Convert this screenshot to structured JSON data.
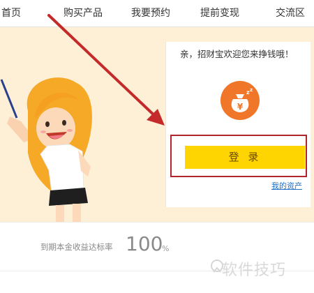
{
  "nav": {
    "items": [
      {
        "label": "首页"
      },
      {
        "label": "购买产品"
      },
      {
        "label": "我要预约"
      },
      {
        "label": "提前变现"
      },
      {
        "label": "交流区"
      }
    ]
  },
  "login_panel": {
    "welcome": "亲，招财宝欢迎您来挣钱哦！",
    "icon": "money-bag-icon",
    "login_label": "登 录",
    "assets_link": "我的资产"
  },
  "rate": {
    "label": "到期本金收益达标率",
    "value": "100",
    "unit": "%"
  },
  "watermark": {
    "text": "软件技巧"
  },
  "colors": {
    "banner_bg": "#fdf0d7",
    "login_button": "#fed500",
    "highlight_frame": "#b2232b",
    "arrow": "#c52a2a",
    "coin": "#f0772a",
    "link": "#1f6fc8"
  }
}
